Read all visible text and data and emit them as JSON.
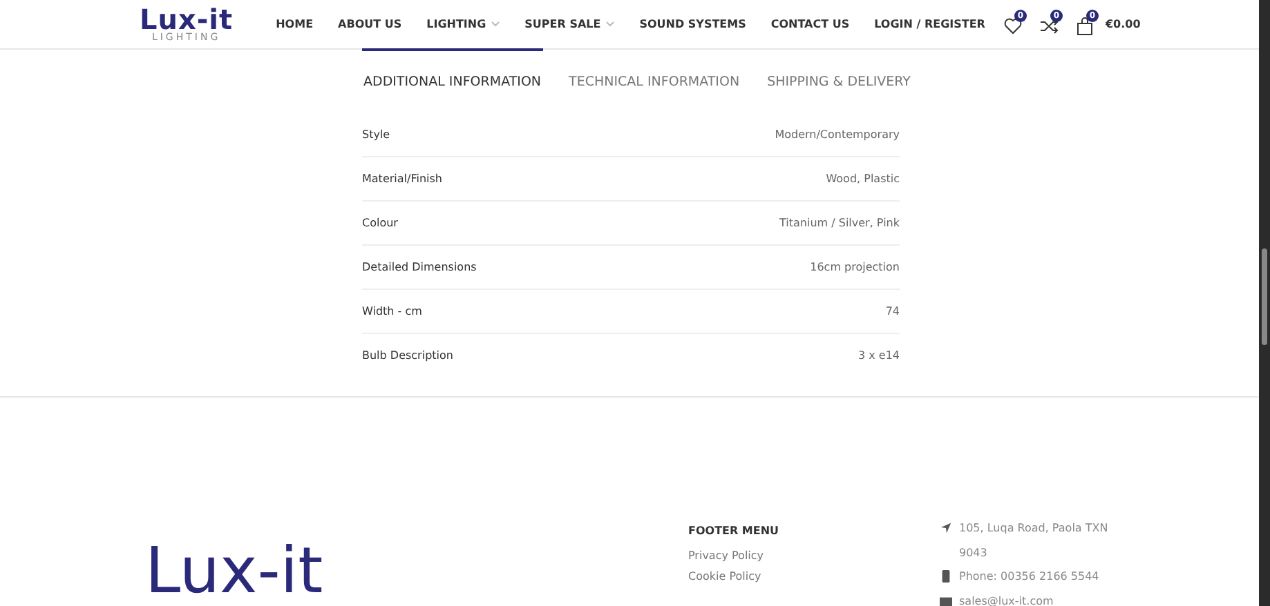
{
  "header": {
    "logo": {
      "main": "Lux-it",
      "sub": "LIGHTING"
    },
    "nav": [
      {
        "label": "HOME",
        "dropdown": false
      },
      {
        "label": "ABOUT US",
        "dropdown": false
      },
      {
        "label": "LIGHTING",
        "dropdown": true
      },
      {
        "label": "SUPER SALE",
        "dropdown": true
      },
      {
        "label": "SOUND SYSTEMS",
        "dropdown": false
      },
      {
        "label": "CONTACT US",
        "dropdown": false
      }
    ],
    "login": "LOGIN / REGISTER",
    "wishlist_count": "0",
    "compare_count": "0",
    "cart_count": "0",
    "cart_total": "€0.00"
  },
  "tabs": [
    {
      "label": "ADDITIONAL INFORMATION",
      "selected": true
    },
    {
      "label": "TECHNICAL INFORMATION",
      "selected": false
    },
    {
      "label": "SHIPPING & DELIVERY",
      "selected": false
    }
  ],
  "attributes": [
    {
      "name": "Style",
      "value": "Modern/Contemporary"
    },
    {
      "name": "Material/Finish",
      "value": "Wood, Plastic"
    },
    {
      "name": "Colour",
      "value": "Titanium / Silver, Pink"
    },
    {
      "name": "Detailed Dimensions",
      "value": "16cm projection"
    },
    {
      "name": "Width - cm",
      "value": "74"
    },
    {
      "name": "Bulb Description",
      "value": "3 x e14"
    }
  ],
  "footer": {
    "logo": "Lux-it",
    "menu_title": "FOOTER MENU",
    "menu": [
      "Privacy Policy",
      "Cookie Policy"
    ],
    "contact": [
      {
        "kind": "address",
        "lines": [
          "105, Luqa Road, Paola TXN",
          "9043"
        ]
      },
      {
        "kind": "phone",
        "lines": [
          "Phone: 00356 2166 5544"
        ]
      },
      {
        "kind": "email",
        "lines": [
          "sales@lux-it.com"
        ]
      }
    ]
  }
}
